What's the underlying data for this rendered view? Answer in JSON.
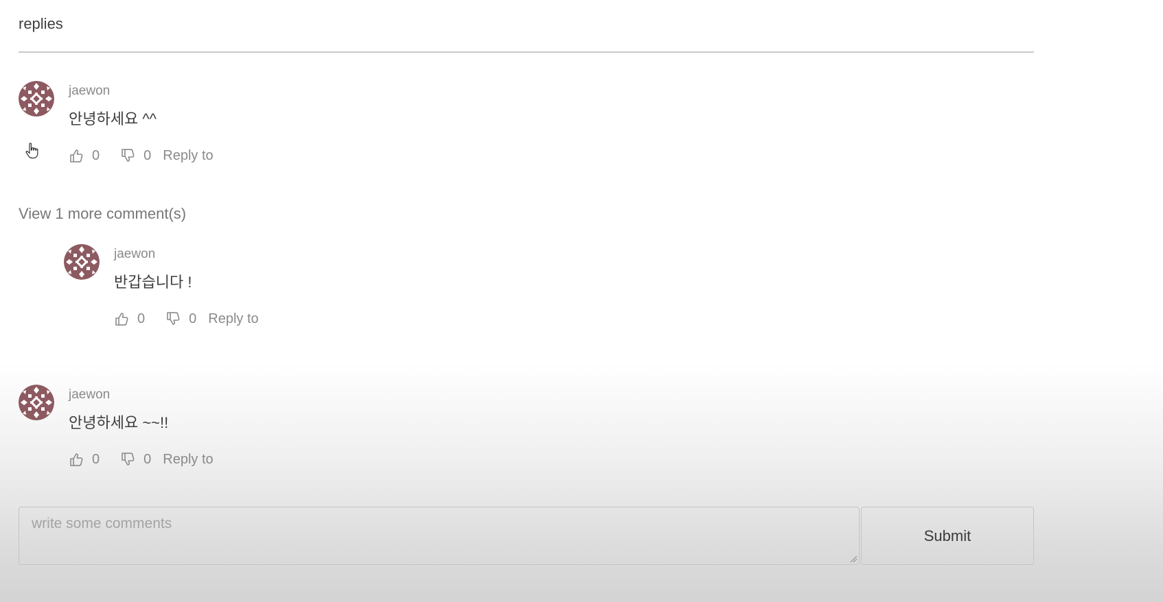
{
  "section": {
    "title": "replies"
  },
  "comments": [
    {
      "author": "jaewon",
      "content": "안녕하세요 ^^",
      "likes": "0",
      "dislikes": "0",
      "reply_label": "Reply to"
    },
    {
      "author": "jaewon",
      "content": "반갑습니다 !",
      "likes": "0",
      "dislikes": "0",
      "reply_label": "Reply to"
    },
    {
      "author": "jaewon",
      "content": "안녕하세요 ~~!!",
      "likes": "0",
      "dislikes": "0",
      "reply_label": "Reply to"
    }
  ],
  "view_more_label": "View 1 more comment(s)",
  "comment_form": {
    "placeholder": "write some comments",
    "submit_label": "Submit"
  },
  "colors": {
    "avatar_bg": "#8c5a60",
    "avatar_pattern": "#ffffff"
  },
  "icons": {
    "like": "thumbs-up-icon",
    "dislike": "thumbs-down-icon",
    "avatar": "identicon-avatar",
    "cursor": "hand-pointer-icon"
  }
}
